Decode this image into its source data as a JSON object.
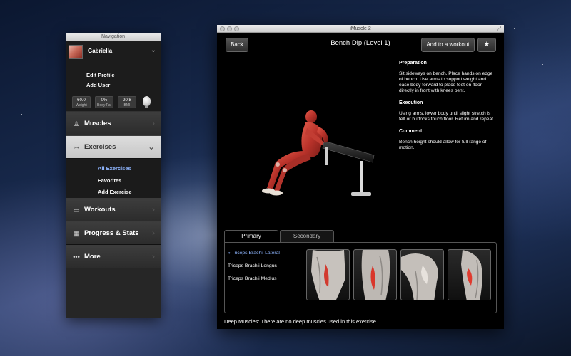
{
  "navigation": {
    "window_title": "Navigation",
    "profile": {
      "name": "Gabriella",
      "links": [
        "Edit Profile",
        "Add User"
      ],
      "stats": [
        {
          "value": "60.0",
          "label": "Weight"
        },
        {
          "value": "0%",
          "label": "Body Fat"
        },
        {
          "value": "20.8",
          "label": "BMI"
        }
      ]
    },
    "items": [
      {
        "label": "Muscles",
        "icon": "figure-icon"
      },
      {
        "label": "Exercises",
        "icon": "dumbbell-icon"
      },
      {
        "label": "Workouts",
        "icon": "workout-card-icon"
      },
      {
        "label": "Progress & Stats",
        "icon": "calendar-icon"
      },
      {
        "label": "More",
        "icon": "more-dots-icon"
      }
    ],
    "exercises_submenu": [
      "All Exercises",
      "Favorites",
      "Add Exercise"
    ]
  },
  "main": {
    "window_title": "iMuscle 2",
    "toolbar": {
      "back_label": "Back",
      "title": "Bench Dip (Level 1)",
      "add_workout_label": "Add to a workout",
      "favorite_label": "★"
    },
    "instructions": [
      {
        "heading": "Preparation",
        "text": "Sit sideways on bench. Place hands on edge of bench. Use arms to support weight and ease body forward to place feet on floor directly in front with knees bent."
      },
      {
        "heading": "Execution",
        "text": "Using arms, lower body until slight stretch is felt or buttocks touch floor. Return and repeat."
      },
      {
        "heading": "Comment",
        "text": "Bench height should allow for full range of motion."
      }
    ],
    "tabs": [
      "Primary",
      "Secondary"
    ],
    "muscles": [
      "» Triceps Brachii Lateral",
      "Triceps Brachii Longus",
      "Triceps Brachii Medius"
    ],
    "deep_muscles_note": "Deep Muscles: There are no deep muscles used in this exercise"
  }
}
